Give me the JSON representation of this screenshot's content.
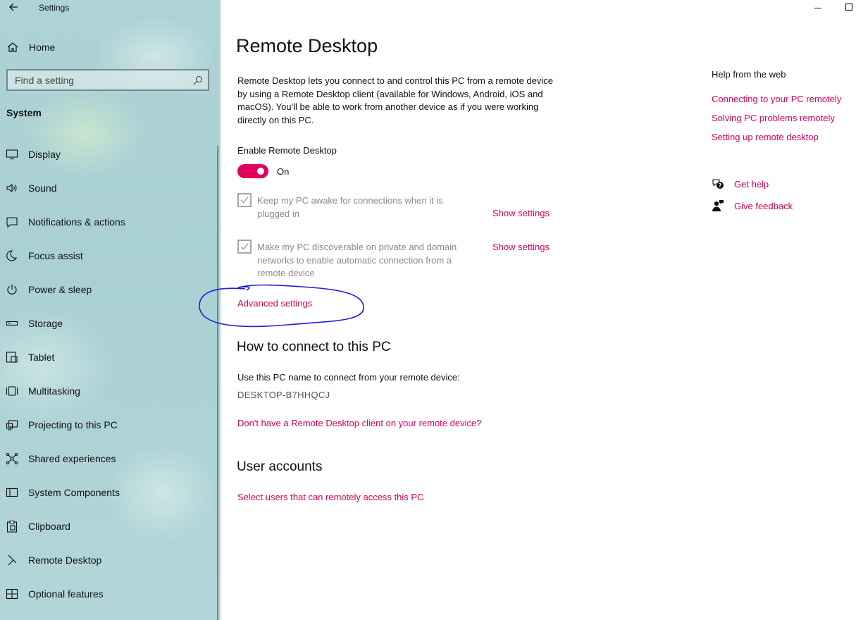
{
  "window": {
    "app_title": "Settings",
    "back_icon": "back-arrow-icon",
    "minimize_icon": "minimize-icon",
    "maximize_icon": "maximize-icon"
  },
  "sidebar": {
    "home_label": "Home",
    "search_placeholder": "Find a setting",
    "section_title": "System",
    "items": [
      {
        "label": "Display",
        "icon": "display-icon"
      },
      {
        "label": "Sound",
        "icon": "sound-icon"
      },
      {
        "label": "Notifications & actions",
        "icon": "notifications-icon"
      },
      {
        "label": "Focus assist",
        "icon": "focus-assist-icon"
      },
      {
        "label": "Power & sleep",
        "icon": "power-icon"
      },
      {
        "label": "Storage",
        "icon": "storage-icon"
      },
      {
        "label": "Tablet",
        "icon": "tablet-icon"
      },
      {
        "label": "Multitasking",
        "icon": "multitasking-icon"
      },
      {
        "label": "Projecting to this PC",
        "icon": "projecting-icon"
      },
      {
        "label": "Shared experiences",
        "icon": "shared-experiences-icon"
      },
      {
        "label": "System Components",
        "icon": "system-components-icon"
      },
      {
        "label": "Clipboard",
        "icon": "clipboard-icon"
      },
      {
        "label": "Remote Desktop",
        "icon": "remote-desktop-icon"
      },
      {
        "label": "Optional features",
        "icon": "optional-features-icon"
      }
    ]
  },
  "main": {
    "title": "Remote Desktop",
    "description": "Remote Desktop lets you connect to and control this PC from a remote device by using a Remote Desktop client (available for Windows, Android, iOS and macOS). You'll be able to work from another device as if you were working directly on this PC.",
    "enable_label": "Enable Remote Desktop",
    "toggle_state": "On",
    "checkbox_awake": "Keep my PC awake for connections when it is plugged in",
    "checkbox_discoverable": "Make my PC discoverable on private and domain networks to enable automatic connection from a remote device",
    "show_settings_1": "Show settings",
    "show_settings_2": "Show settings",
    "advanced_settings": "Advanced settings",
    "how_to_connect_title": "How to connect to this PC",
    "pc_name_label": "Use this PC name to connect from your remote device:",
    "pc_name": "DESKTOP-B7HHQCJ",
    "no_client_link": "Don't have a Remote Desktop client on your remote device?",
    "user_accounts_title": "User accounts",
    "select_users_link": "Select users that can remotely access this PC"
  },
  "help": {
    "title": "Help from the web",
    "links": [
      "Connecting to your PC remotely",
      "Solving PC problems remotely",
      "Setting up remote desktop"
    ],
    "get_help": "Get help",
    "give_feedback": "Give feedback"
  },
  "colors": {
    "accent": "#e3005f",
    "link": "#d4005a",
    "annotation": "#1f1fd6"
  }
}
